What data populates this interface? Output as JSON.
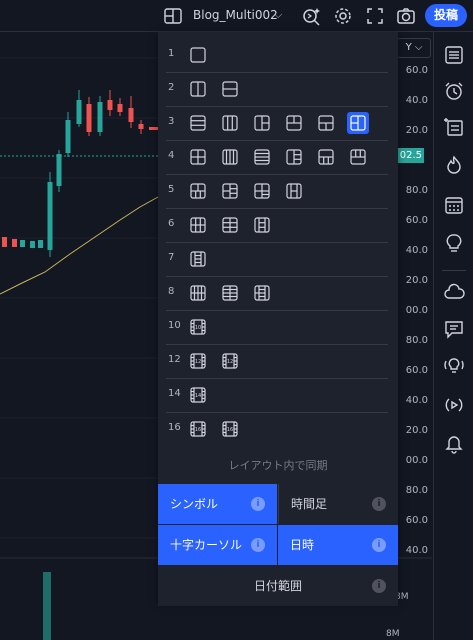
{
  "topbar": {
    "layout_name": "Blog_Multi002",
    "post_label": "投稿"
  },
  "price_axis": {
    "dropdown_label": "Y",
    "labels": [
      "60.0",
      "40.0",
      "20.0",
      "00.0",
      "80.0",
      "60.0",
      "40.0",
      "20.0",
      "00.0",
      "80.0",
      "60.0",
      "40.0",
      "20.0",
      "00.0",
      "80.0",
      "60.0",
      "40.0"
    ],
    "current_price": "02.5"
  },
  "volume_axis": {
    "labels": [
      "8M",
      "8M"
    ]
  },
  "layouts": {
    "rows": [
      {
        "num": "1",
        "count": 1
      },
      {
        "num": "2",
        "count": 2
      },
      {
        "num": "3",
        "count": 6,
        "selected_index": 5
      },
      {
        "num": "4",
        "count": 6
      },
      {
        "num": "5",
        "count": 4
      },
      {
        "num": "6",
        "count": 3
      },
      {
        "num": "7",
        "count": 1
      },
      {
        "num": "8",
        "count": 3
      },
      {
        "num": "10",
        "count": 1
      },
      {
        "num": "12",
        "count": 2
      },
      {
        "num": "14",
        "count": 1
      },
      {
        "num": "16",
        "count": 2
      }
    ]
  },
  "sync": {
    "title": "レイアウト内で同期",
    "symbol_label": "シンボル",
    "interval_label": "時間足",
    "crosshair_label": "十字カーソル",
    "time_label": "日時",
    "date_range_label": "日付範囲",
    "info_glyph": "i"
  },
  "colors": {
    "accent": "#2962ff",
    "up": "#26a69a",
    "down": "#ef5350",
    "ma_line": "#c9b458",
    "panel_bg": "#1e222d",
    "page_bg": "#131722"
  }
}
